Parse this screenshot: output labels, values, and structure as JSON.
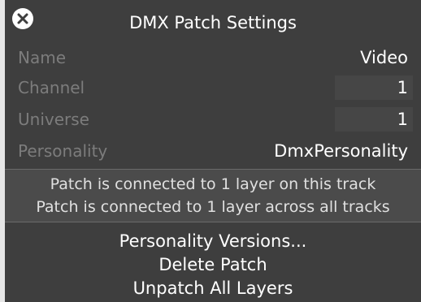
{
  "dialog": {
    "title": "DMX Patch Settings",
    "close_icon": "close-icon"
  },
  "fields": {
    "name": {
      "label": "Name",
      "value": "Video"
    },
    "channel": {
      "label": "Channel",
      "value": "1"
    },
    "universe": {
      "label": "Universe",
      "value": "1"
    },
    "personality": {
      "label": "Personality",
      "value": "DmxPersonality"
    }
  },
  "info": {
    "line1": "Patch is connected to 1 layer on this track",
    "line2": "Patch is connected to 1 layer across all tracks"
  },
  "actions": {
    "personality_versions": "Personality Versions...",
    "delete_patch": "Delete Patch",
    "unpatch_all": "Unpatch All Layers"
  },
  "colors": {
    "panel_bg": "#3e3e3e",
    "label_text": "#7c7c7c",
    "value_text": "#ffffff",
    "info_bg": "#4b4b4b"
  }
}
